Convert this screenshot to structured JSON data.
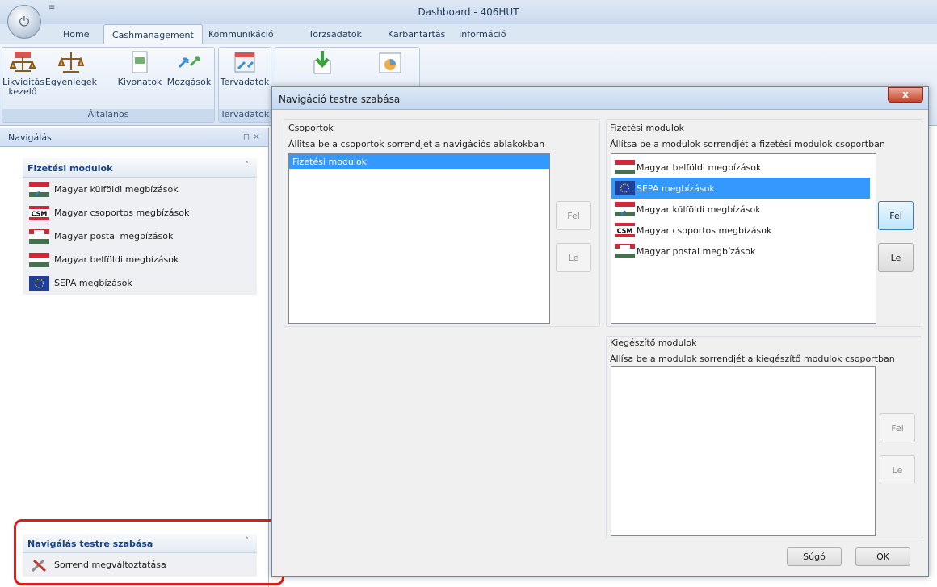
{
  "window": {
    "title": "Dashboard - 406HUT",
    "qat": "≡"
  },
  "ribbon_tabs": [
    "Home",
    "Cashmanagement",
    "Kommunikáció",
    "Törzsadatok",
    "Karbantartás",
    "Információ"
  ],
  "ribbon": {
    "groups": [
      {
        "label": "Általános",
        "buttons": [
          "Likviditás\nkezelő",
          "Egyenlegek",
          "Kivonatok",
          "Mozgások"
        ]
      },
      {
        "label": "Tervadatok",
        "buttons": [
          "Tervadatok"
        ]
      }
    ]
  },
  "nav": {
    "header": "Navigálás",
    "pin": "⊓ ✕",
    "group1": {
      "title": "Fizetési modulok",
      "items": [
        "Magyar külföldi megbízások",
        "Magyar csoportos megbízások",
        "Magyar postai megbízások",
        "Magyar belföldi megbízások",
        "SEPA megbízások"
      ]
    },
    "group2": {
      "title": "Navigálás testre szabása",
      "items": [
        "Sorrend megváltoztatása"
      ]
    },
    "chevron": "˄"
  },
  "dialog": {
    "title": "Navigáció testre szabása",
    "close": "x",
    "groups_panel": {
      "label": "Csoportok",
      "desc": "Állítsa be a csoportok sorrendjét a navigációs ablakokban",
      "items": [
        "Fizetési modulok"
      ],
      "up": "Fel",
      "down": "Le"
    },
    "payment_panel": {
      "label": "Fizetési modulok",
      "desc": "Állítsa be a modulok sorrendjét a fizetési modulok csoportban",
      "items": [
        "Magyar belföldi megbízások",
        "SEPA megbízások",
        "Magyar külföldi megbízások",
        "Magyar csoportos megbízások",
        "Magyar postai megbízások"
      ],
      "selected_index": 1,
      "up": "Fel",
      "down": "Le"
    },
    "extra_panel": {
      "label": "Kiegészítő modulok",
      "desc": "Állísa be a modulok sorrendjét a kiegészítő modulok csoportban",
      "up": "Fel",
      "down": "Le"
    },
    "help": "Súgó",
    "ok": "OK"
  },
  "colors": {
    "accent": "#3399ff",
    "highlight": "#e01b1b",
    "nav_title": "#15428b"
  }
}
